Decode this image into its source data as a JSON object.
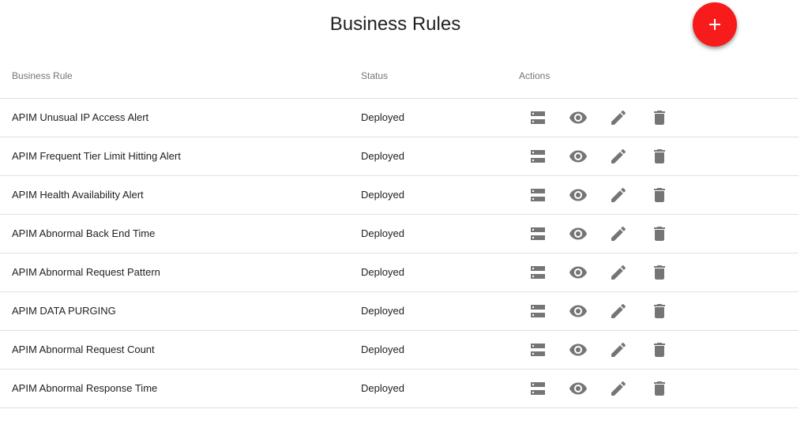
{
  "header": {
    "title": "Business Rules"
  },
  "fab": {
    "icon": "plus-icon",
    "color": "#f71b1b"
  },
  "table": {
    "columns": {
      "name": "Business Rule",
      "status": "Status",
      "actions": "Actions"
    },
    "rows": [
      {
        "name": "APIM Unusual IP Access Alert",
        "status": "Deployed"
      },
      {
        "name": "APIM Frequent Tier Limit Hitting Alert",
        "status": "Deployed"
      },
      {
        "name": "APIM Health Availability Alert",
        "status": "Deployed"
      },
      {
        "name": "APIM Abnormal Back End Time",
        "status": "Deployed"
      },
      {
        "name": "APIM Abnormal Request Pattern",
        "status": "Deployed"
      },
      {
        "name": "APIM DATA PURGING",
        "status": "Deployed"
      },
      {
        "name": "APIM Abnormal Request Count",
        "status": "Deployed"
      },
      {
        "name": "APIM Abnormal Response Time",
        "status": "Deployed"
      }
    ],
    "action_icons": [
      "deploy-info-icon",
      "view-icon",
      "edit-icon",
      "delete-icon"
    ]
  }
}
